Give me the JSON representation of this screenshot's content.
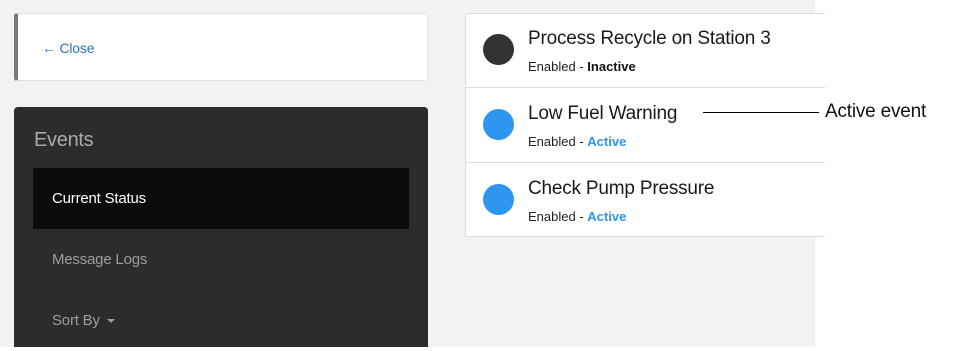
{
  "close": {
    "label": "← Close"
  },
  "sidebar": {
    "title": "Events",
    "items": [
      {
        "label": "Current Status",
        "active": true
      },
      {
        "label": "Message Logs"
      },
      {
        "label": "Sort By",
        "has_dropdown": true
      }
    ]
  },
  "events": [
    {
      "name": "Process Recycle on Station 3",
      "enabled": "Enabled",
      "separator": " - ",
      "state": "Inactive",
      "dot_color": "#333333",
      "state_color": "#111111"
    },
    {
      "name": "Low Fuel Warning",
      "enabled": "Enabled",
      "separator": " - ",
      "state": "Active",
      "dot_color": "#2e96f0",
      "state_color": "#2e96f0"
    },
    {
      "name": "Check Pump Pressure",
      "enabled": "Enabled",
      "separator": " - ",
      "state": "Active",
      "dot_color": "#2e96f0",
      "state_color": "#2e96f0"
    }
  ],
  "annotation": {
    "text": "Active event"
  }
}
